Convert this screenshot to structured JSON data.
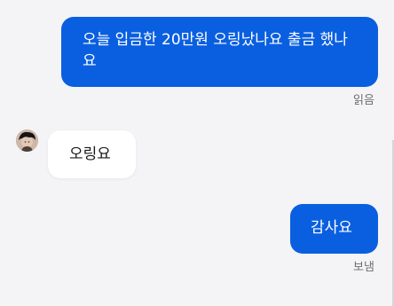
{
  "messages": [
    {
      "direction": "sent",
      "text": "오늘 입금한 20만원 오링났나요 출금 했나요",
      "status": "읽음"
    },
    {
      "direction": "received",
      "text": "오링요"
    },
    {
      "direction": "sent",
      "text": "감사요",
      "status": "보냄"
    }
  ],
  "colors": {
    "sent_bubble": "#0a5fe0",
    "received_bubble": "#ffffff",
    "background": "#f4f3f5",
    "status_text": "#6f6f6f"
  },
  "icons": {
    "avatar": "user-avatar-icon"
  }
}
